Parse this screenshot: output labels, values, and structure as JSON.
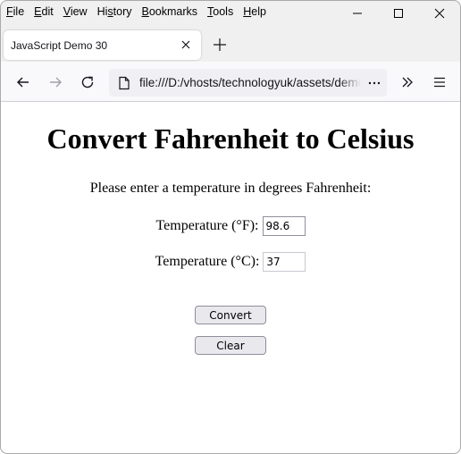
{
  "menubar": {
    "items": [
      {
        "label": "File",
        "accesskey": "F",
        "rest": "ile"
      },
      {
        "label": "Edit",
        "accesskey": "E",
        "rest": "dit"
      },
      {
        "label": "View",
        "accesskey": "V",
        "rest": "iew"
      },
      {
        "label": "History",
        "pre": "Hi",
        "accesskey": "s",
        "rest": "tory"
      },
      {
        "label": "Bookmarks",
        "accesskey": "B",
        "rest": "ookmarks"
      },
      {
        "label": "Tools",
        "accesskey": "T",
        "rest": "ools"
      },
      {
        "label": "Help",
        "accesskey": "H",
        "rest": "elp"
      }
    ]
  },
  "window_controls": [
    "minimize-icon",
    "maximize-icon",
    "close-icon"
  ],
  "tabs": [
    {
      "title": "JavaScript Demo 30",
      "active": true
    }
  ],
  "toolbar": {
    "url": "file:///D:/vhosts/technologyuk/assets/demos/",
    "icons": [
      "back-arrow-icon",
      "forward-arrow-icon",
      "reload-icon",
      "page-icon",
      "more-icon",
      "overflow-chevrons-icon",
      "hamburger-menu-icon"
    ]
  },
  "page": {
    "heading": "Convert Fahrenheit to Celsius",
    "prompt": "Please enter a temperature in degrees Fahrenheit:",
    "fahrenheit": {
      "label": "Temperature (°F):",
      "value": "98.6"
    },
    "celsius": {
      "label": "Temperature (°C):",
      "value": "37"
    },
    "convert_label": "Convert",
    "clear_label": "Clear"
  }
}
